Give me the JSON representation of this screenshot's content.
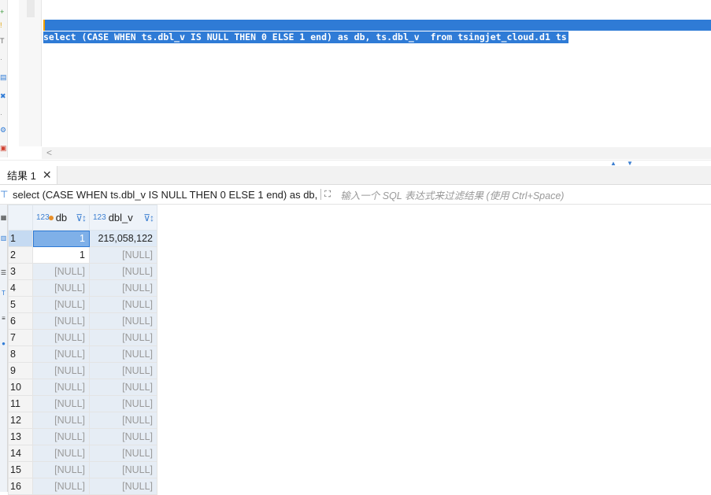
{
  "editor": {
    "sql_text": "select (CASE WHEN ts.dbl_v IS NULL THEN 0 ELSE 1 end) as db, ts.dbl_v  from tsingjet_cloud.d1 ts"
  },
  "left_toolbar": {
    "icons": [
      "plus-icon",
      "info-icon",
      "filter-icon",
      "dot-icon",
      "table-icon",
      "link-icon",
      "dot-icon",
      "settings-icon",
      "export-icon"
    ]
  },
  "results": {
    "tab_label": "结果 1",
    "close_glyph": "✕",
    "filter_sql": "select (CASE WHEN ts.dbl_v IS NULL THEN 0 ELSE 1 end) as db,",
    "filter_placeholder": "输入一个 SQL 表达式来过滤结果 (使用 Ctrl+Space)",
    "columns": [
      {
        "type": "123",
        "name": "db"
      },
      {
        "type": "123",
        "name": "dbl_v"
      }
    ],
    "rows": [
      {
        "n": "1",
        "db": "1",
        "dbl_v": "215,058,122"
      },
      {
        "n": "2",
        "db": "1",
        "dbl_v": "[NULL]"
      },
      {
        "n": "3",
        "db": "[NULL]",
        "dbl_v": "[NULL]"
      },
      {
        "n": "4",
        "db": "[NULL]",
        "dbl_v": "[NULL]"
      },
      {
        "n": "5",
        "db": "[NULL]",
        "dbl_v": "[NULL]"
      },
      {
        "n": "6",
        "db": "[NULL]",
        "dbl_v": "[NULL]"
      },
      {
        "n": "7",
        "db": "[NULL]",
        "dbl_v": "[NULL]"
      },
      {
        "n": "8",
        "db": "[NULL]",
        "dbl_v": "[NULL]"
      },
      {
        "n": "9",
        "db": "[NULL]",
        "dbl_v": "[NULL]"
      },
      {
        "n": "10",
        "db": "[NULL]",
        "dbl_v": "[NULL]"
      },
      {
        "n": "11",
        "db": "[NULL]",
        "dbl_v": "[NULL]"
      },
      {
        "n": "12",
        "db": "[NULL]",
        "dbl_v": "[NULL]"
      },
      {
        "n": "13",
        "db": "[NULL]",
        "dbl_v": "[NULL]"
      },
      {
        "n": "14",
        "db": "[NULL]",
        "dbl_v": "[NULL]"
      },
      {
        "n": "15",
        "db": "[NULL]",
        "dbl_v": "[NULL]"
      },
      {
        "n": "16",
        "db": "[NULL]",
        "dbl_v": "[NULL]"
      }
    ]
  },
  "colors": {
    "selection": "#2f7bd6",
    "cursor": "#f2a000",
    "null_text": "#9a9a9a"
  }
}
